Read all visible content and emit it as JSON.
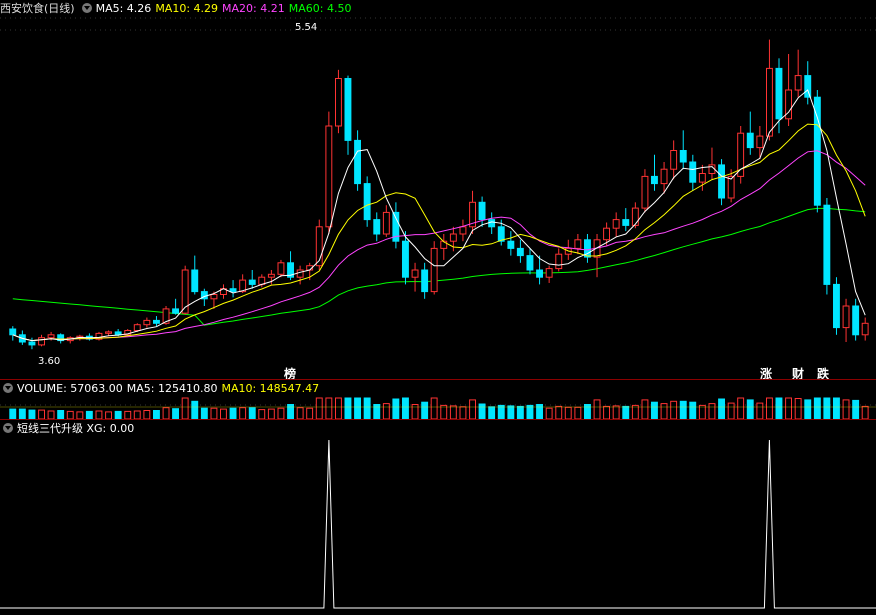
{
  "main": {
    "title": "西安饮食(日线)",
    "ma": [
      {
        "label": "MA5: 4.26",
        "color": "#ffffff"
      },
      {
        "label": "MA10: 4.29",
        "color": "#ffff00"
      },
      {
        "label": "MA20: 4.21",
        "color": "#ff44ff"
      },
      {
        "label": "MA60: 4.50",
        "color": "#00ff00"
      }
    ],
    "high_label": "5.54",
    "low_label": "3.60",
    "tags": [
      {
        "text": "榜",
        "color": "#ff9900"
      },
      {
        "text": "涨",
        "color": "#ff3333"
      },
      {
        "text": "财",
        "color": "#44aaff"
      },
      {
        "text": "跌",
        "color": "#00dd00"
      }
    ]
  },
  "volume": {
    "label": "VOLUME: 57063.00",
    "ma5": "MA5: 125410.80",
    "ma10": "MA10: 148547.47"
  },
  "indicator": {
    "label": "短线三代升级 XG: 0.00"
  },
  "colors": {
    "up": "#ff3333",
    "down": "#00e5ff",
    "ma5": "#ffffff",
    "ma10": "#ffff00",
    "ma20": "#ff44ff",
    "ma60": "#00ff00"
  },
  "chart_data": {
    "type": "candlestick",
    "price_range": [
      3.4,
      5.9
    ],
    "candles": [
      [
        3.74,
        3.76,
        3.66,
        3.7
      ],
      [
        3.7,
        3.73,
        3.63,
        3.65
      ],
      [
        3.65,
        3.68,
        3.6,
        3.63
      ],
      [
        3.63,
        3.7,
        3.62,
        3.68
      ],
      [
        3.68,
        3.72,
        3.66,
        3.7
      ],
      [
        3.7,
        3.71,
        3.64,
        3.66
      ],
      [
        3.66,
        3.69,
        3.64,
        3.68
      ],
      [
        3.68,
        3.7,
        3.66,
        3.69
      ],
      [
        3.69,
        3.71,
        3.66,
        3.67
      ],
      [
        3.67,
        3.72,
        3.66,
        3.71
      ],
      [
        3.71,
        3.73,
        3.69,
        3.72
      ],
      [
        3.72,
        3.74,
        3.69,
        3.7
      ],
      [
        3.7,
        3.74,
        3.69,
        3.73
      ],
      [
        3.73,
        3.78,
        3.72,
        3.77
      ],
      [
        3.77,
        3.82,
        3.75,
        3.8
      ],
      [
        3.8,
        3.83,
        3.76,
        3.78
      ],
      [
        3.78,
        3.9,
        3.77,
        3.88
      ],
      [
        3.88,
        3.95,
        3.84,
        3.85
      ],
      [
        3.85,
        4.18,
        3.84,
        4.15
      ],
      [
        4.15,
        4.25,
        3.98,
        4.0
      ],
      [
        4.0,
        4.02,
        3.9,
        3.95
      ],
      [
        3.95,
        4.0,
        3.88,
        3.98
      ],
      [
        3.98,
        4.05,
        3.95,
        4.02
      ],
      [
        4.02,
        4.08,
        3.96,
        4.0
      ],
      [
        4.0,
        4.12,
        3.99,
        4.08
      ],
      [
        4.08,
        4.15,
        4.02,
        4.05
      ],
      [
        4.05,
        4.12,
        4.03,
        4.1
      ],
      [
        4.1,
        4.15,
        4.05,
        4.12
      ],
      [
        4.12,
        4.22,
        4.1,
        4.2
      ],
      [
        4.2,
        4.28,
        4.08,
        4.1
      ],
      [
        4.1,
        4.18,
        4.05,
        4.15
      ],
      [
        4.15,
        4.2,
        4.08,
        4.18
      ],
      [
        4.18,
        4.5,
        4.15,
        4.45
      ],
      [
        4.45,
        5.25,
        4.4,
        5.15
      ],
      [
        5.15,
        5.54,
        5.1,
        5.48
      ],
      [
        5.48,
        5.5,
        4.95,
        5.05
      ],
      [
        5.05,
        5.12,
        4.7,
        4.75
      ],
      [
        4.75,
        4.8,
        4.45,
        4.5
      ],
      [
        4.5,
        4.55,
        4.35,
        4.4
      ],
      [
        4.4,
        4.6,
        4.38,
        4.55
      ],
      [
        4.55,
        4.62,
        4.3,
        4.35
      ],
      [
        4.35,
        4.42,
        4.05,
        4.1
      ],
      [
        4.1,
        4.2,
        4.0,
        4.15
      ],
      [
        4.15,
        4.2,
        3.95,
        4.0
      ],
      [
        4.0,
        4.35,
        3.98,
        4.3
      ],
      [
        4.3,
        4.4,
        4.22,
        4.35
      ],
      [
        4.35,
        4.45,
        4.28,
        4.4
      ],
      [
        4.4,
        4.5,
        4.35,
        4.45
      ],
      [
        4.45,
        4.7,
        4.4,
        4.62
      ],
      [
        4.62,
        4.66,
        4.45,
        4.5
      ],
      [
        4.5,
        4.55,
        4.4,
        4.45
      ],
      [
        4.45,
        4.5,
        4.32,
        4.35
      ],
      [
        4.35,
        4.42,
        4.25,
        4.3
      ],
      [
        4.3,
        4.36,
        4.2,
        4.25
      ],
      [
        4.25,
        4.3,
        4.12,
        4.15
      ],
      [
        4.15,
        4.25,
        4.05,
        4.1
      ],
      [
        4.1,
        4.18,
        4.06,
        4.16
      ],
      [
        4.16,
        4.3,
        4.14,
        4.26
      ],
      [
        4.26,
        4.36,
        4.22,
        4.3
      ],
      [
        4.3,
        4.4,
        4.26,
        4.36
      ],
      [
        4.36,
        4.4,
        4.2,
        4.24
      ],
      [
        4.24,
        4.4,
        4.1,
        4.36
      ],
      [
        4.36,
        4.48,
        4.32,
        4.44
      ],
      [
        4.44,
        4.55,
        4.38,
        4.5
      ],
      [
        4.5,
        4.58,
        4.42,
        4.46
      ],
      [
        4.46,
        4.62,
        4.44,
        4.58
      ],
      [
        4.58,
        4.85,
        4.55,
        4.8
      ],
      [
        4.8,
        4.95,
        4.7,
        4.75
      ],
      [
        4.75,
        4.9,
        4.68,
        4.85
      ],
      [
        4.85,
        5.05,
        4.78,
        4.98
      ],
      [
        4.98,
        5.12,
        4.85,
        4.9
      ],
      [
        4.9,
        4.95,
        4.7,
        4.76
      ],
      [
        4.76,
        4.88,
        4.7,
        4.82
      ],
      [
        4.82,
        5.0,
        4.78,
        4.88
      ],
      [
        4.88,
        4.92,
        4.6,
        4.65
      ],
      [
        4.65,
        4.85,
        4.62,
        4.8
      ],
      [
        4.8,
        5.15,
        4.75,
        5.1
      ],
      [
        5.1,
        5.25,
        4.95,
        5.0
      ],
      [
        5.0,
        5.15,
        4.92,
        5.08
      ],
      [
        5.08,
        5.75,
        5.05,
        5.55
      ],
      [
        5.55,
        5.62,
        5.1,
        5.2
      ],
      [
        5.2,
        5.65,
        5.15,
        5.4
      ],
      [
        5.4,
        5.68,
        5.35,
        5.5
      ],
      [
        5.5,
        5.6,
        5.3,
        5.35
      ],
      [
        5.35,
        5.4,
        4.55,
        4.6
      ],
      [
        4.6,
        4.65,
        3.98,
        4.05
      ],
      [
        4.05,
        4.1,
        3.7,
        3.75
      ],
      [
        3.75,
        3.95,
        3.65,
        3.9
      ],
      [
        3.9,
        3.95,
        3.66,
        3.7
      ],
      [
        3.7,
        3.82,
        3.66,
        3.78
      ]
    ],
    "volume_range": [
      0,
      520000
    ],
    "xg_signal_index": [
      33,
      79
    ]
  }
}
